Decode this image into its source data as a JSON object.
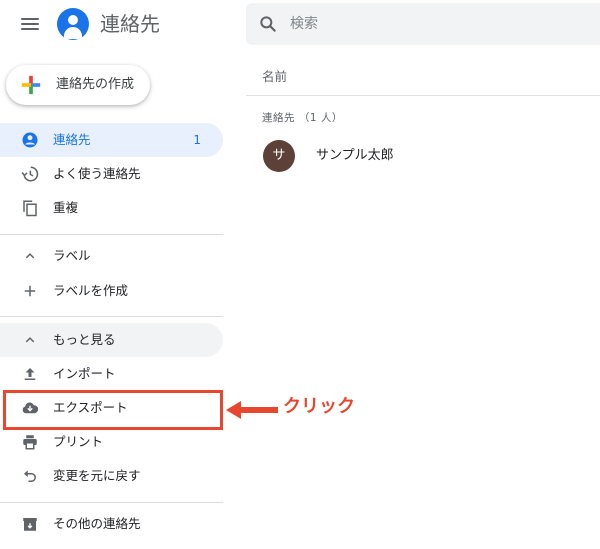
{
  "app": {
    "title": "連絡先"
  },
  "search": {
    "placeholder": "検索",
    "value": ""
  },
  "create_button": {
    "label": "連絡先の作成"
  },
  "sidebar": {
    "items": [
      {
        "label": "連絡先",
        "count": "1",
        "icon": "person-icon",
        "active": true
      },
      {
        "label": "よく使う連絡先",
        "icon": "history-icon"
      },
      {
        "label": "重複",
        "icon": "copy-icon"
      }
    ],
    "labels_section": {
      "label": "ラベル",
      "icon": "chevron-up-icon"
    },
    "create_label": {
      "label": "ラベルを作成",
      "icon": "plus-icon"
    },
    "more": {
      "label": "もっと見る",
      "icon": "chevron-up-icon"
    },
    "more_items": [
      {
        "label": "インポート",
        "icon": "upload-icon"
      },
      {
        "label": "エクスポート",
        "icon": "cloud-download-icon"
      },
      {
        "label": "プリント",
        "icon": "printer-icon"
      },
      {
        "label": "変更を元に戻す",
        "icon": "undo-icon"
      }
    ],
    "other_contacts": {
      "label": "その他の連絡先",
      "icon": "archive-icon"
    }
  },
  "main": {
    "column_header": "名前",
    "group_label": "連絡先 （1 人）",
    "contacts": [
      {
        "initial": "サ",
        "name": "サンプル太郎",
        "avatar_color": "#5d4037"
      }
    ]
  },
  "annotation": {
    "text": "クリック",
    "color": "#e8472f"
  },
  "colors": {
    "accent": "#1a73e8",
    "active_bg": "#e8f0fe"
  }
}
